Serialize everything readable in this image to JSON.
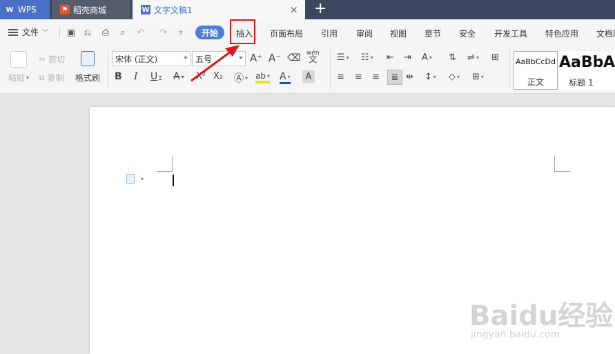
{
  "tabs": {
    "wps": {
      "label": "WPS"
    },
    "store": {
      "label": "稻壳商城"
    },
    "doc": {
      "label": "文字文稿1"
    },
    "close_glyph": "×",
    "add_glyph": "+"
  },
  "menubar": {
    "file_label": "文件",
    "start_label": "开始",
    "items": [
      "插入",
      "页面布局",
      "引用",
      "审阅",
      "视图",
      "章节",
      "安全",
      "开发工具",
      "特色应用",
      "文档助"
    ]
  },
  "ribbon": {
    "paste_label": "粘贴",
    "cut_label": "剪切",
    "copy_label": "复制",
    "format_painter_label": "格式刷",
    "font_name": "宋体 (正文)",
    "font_size": "五号",
    "phonetic_glyph": "wén",
    "styles": [
      {
        "preview": "AaBbCcDd",
        "label": "正文"
      },
      {
        "preview": "AaBb",
        "label": "标题 1"
      },
      {
        "preview": "A",
        "label": ""
      }
    ]
  },
  "watermark": {
    "text": "Baidu经验",
    "sub": "jingyan.baidu.com"
  },
  "colors": {
    "accent": "#4b7fd6",
    "annotation": "#e0161c",
    "tabbar": "#3b4660"
  }
}
